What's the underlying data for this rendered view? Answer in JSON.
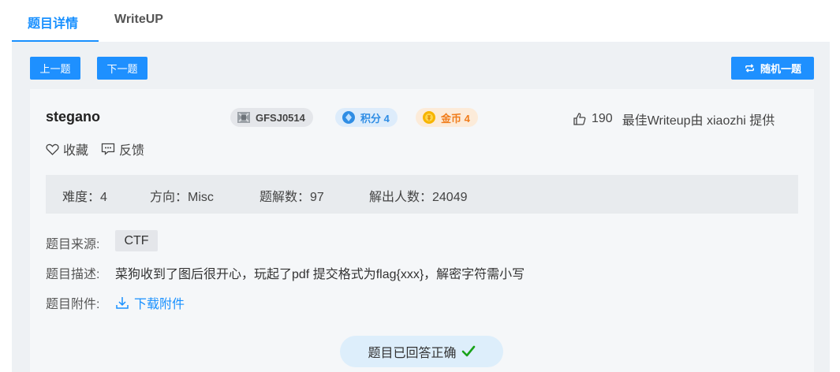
{
  "tabs": [
    {
      "label": "题目详情",
      "active": true
    },
    {
      "label": "WriteUP",
      "active": false
    }
  ],
  "nav": {
    "prev_label": "上一题",
    "next_label": "下一题",
    "random_label": "随机一题"
  },
  "challenge": {
    "title": "stegano",
    "badges": {
      "id": "GFSJ0514",
      "score": "积分 4",
      "coins": "金币 4"
    },
    "likes": "190",
    "best_writeup": "最佳Writeup由 xiaozhi 提供",
    "favorite_label": "收藏",
    "feedback_label": "反馈"
  },
  "stats": {
    "difficulty": "难度：4",
    "direction": "方向：Misc",
    "solves": "题解数：97",
    "solvers": "解出人数：24049"
  },
  "details": {
    "source_label": "题目来源:",
    "source_value": "CTF",
    "description_label": "题目描述:",
    "description": "菜狗收到了图后很开心，玩起了pdf 提交格式为flag{xxx}，解密字符需小写",
    "attachment_label": "题目附件:",
    "download_label": "下载附件"
  },
  "status": {
    "answered": "题目已回答正确"
  },
  "colors": {
    "accent": "#1890ff",
    "button": "#1e90ff",
    "success": "#19a319",
    "coin": "#f07c1a"
  },
  "icons": [
    "shuffle-icon",
    "gfsj-logo-icon",
    "score-gem-icon",
    "coin-icon",
    "thumbs-up-icon",
    "heart-icon",
    "comment-icon",
    "download-icon",
    "check-icon"
  ]
}
